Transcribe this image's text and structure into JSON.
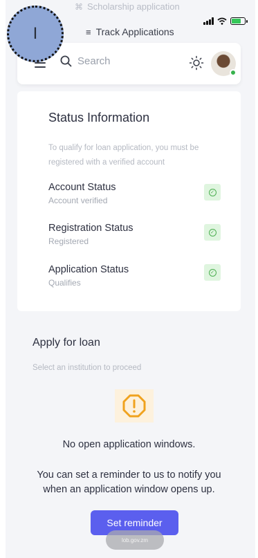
{
  "overlay": {
    "menu_item_scholarship": "Scholarship application",
    "menu_item_track": "Track Applications",
    "bubble_letter": "I"
  },
  "header": {
    "search_label": "Search",
    "icons": [
      "menu-icon",
      "search-icon",
      "theme-toggle-sun-icon",
      "profile-avatar"
    ]
  },
  "status_card": {
    "title": "Status Information",
    "description": "To qualify for loan application, you must be registered with a verified account",
    "rows": [
      {
        "title": "Account Status",
        "subtitle": "Account verified"
      },
      {
        "title": "Registration Status",
        "subtitle": "Registered"
      },
      {
        "title": "Application Status",
        "subtitle": "Qualifies"
      }
    ]
  },
  "apply": {
    "title": "Apply for loan",
    "subtitle": "Select an institution to proceed",
    "empty_message": "No open application windows.",
    "reminder_message": "You can set a reminder to us to notify you when an application window opens up.",
    "button_label": "Set reminder"
  },
  "browser": {
    "url_fragment": "lob.gov.zm"
  },
  "colors": {
    "accent": "#5b5fee",
    "success": "#4caf50",
    "warning": "#f0a21e",
    "online": "#37b24d"
  }
}
